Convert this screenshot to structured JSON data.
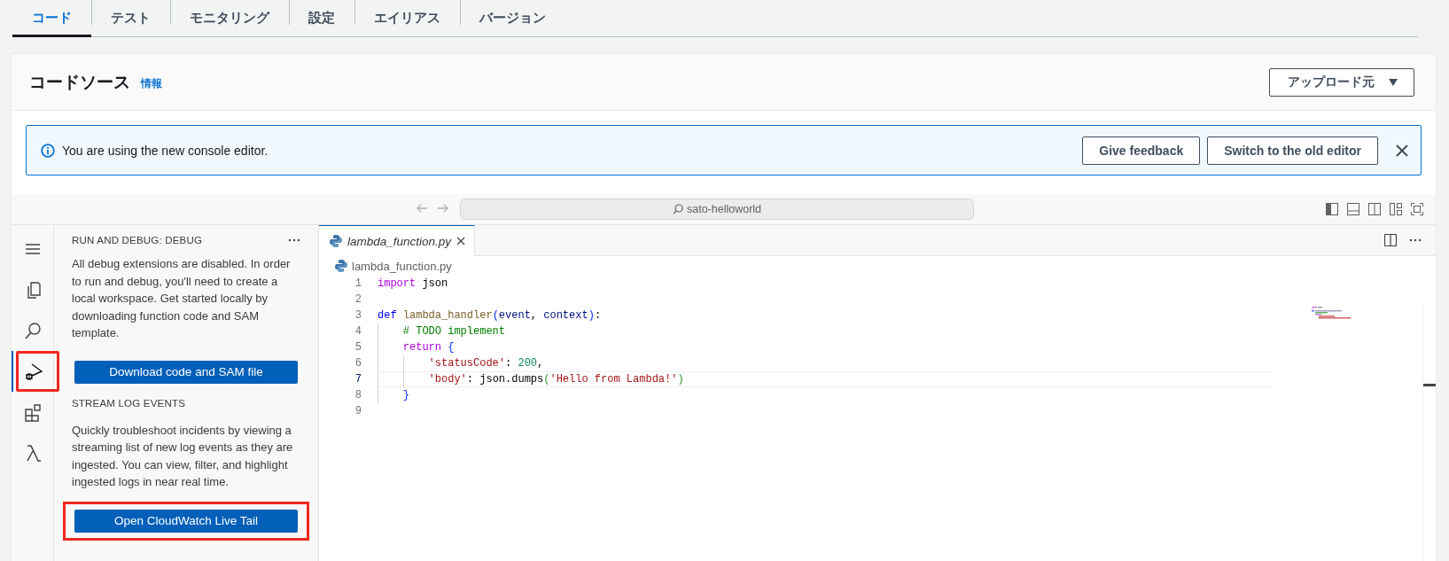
{
  "tabs": [
    {
      "label": "コード",
      "selected": true
    },
    {
      "label": "テスト",
      "selected": false
    },
    {
      "label": "モニタリング",
      "selected": false
    },
    {
      "label": "設定",
      "selected": false
    },
    {
      "label": "エイリアス",
      "selected": false
    },
    {
      "label": "バージョン",
      "selected": false
    }
  ],
  "code_source": {
    "title": "コードソース",
    "info_link": "情報",
    "upload_button": "アップロード元"
  },
  "alert": {
    "message": "You are using the new console editor.",
    "buttons": [
      "Give feedback",
      "Switch to the old editor"
    ]
  },
  "editor": {
    "title_search": "sato-helloworld",
    "activity_bar": [
      {
        "kind": "menu",
        "selected": false,
        "highlighted": false
      },
      {
        "kind": "explorer",
        "selected": false,
        "highlighted": false
      },
      {
        "kind": "search",
        "selected": false,
        "highlighted": false
      },
      {
        "kind": "debug",
        "selected": true,
        "highlighted": true
      },
      {
        "kind": "extensions",
        "selected": false,
        "highlighted": false
      },
      {
        "kind": "lambda",
        "selected": false,
        "highlighted": false
      }
    ],
    "sidebar": [
      {
        "title": "RUN AND DEBUG: DEBUG",
        "text": "All debug extensions are disabled. In order to run and debug, you'll need to create a local workspace. Get started locally by downloading function code and SAM template.",
        "button": "Download code and SAM file",
        "button_highlighted": false
      },
      {
        "title": "STREAM LOG EVENTS",
        "text": "Quickly troubleshoot incidents by viewing a streaming list of new log events as they are ingested. You can view, filter, and highlight ingested logs in near real time.",
        "button": "Open CloudWatch Live Tail",
        "button_highlighted": true
      }
    ],
    "open_tabs": [
      {
        "label": "lambda_function.py",
        "selected": true,
        "preview": true
      }
    ],
    "breadcrumb": "lambda_function.py",
    "lines": [
      {
        "number": "1",
        "current": false,
        "tokens": [
          {
            "text": "import",
            "kind": "keyword"
          },
          {
            "text": " json",
            "kind": "plain"
          }
        ]
      },
      {
        "number": "2",
        "current": false
      },
      {
        "number": "3",
        "current": false,
        "tokens": [
          {
            "text": "def",
            "kind": "storage"
          },
          {
            "text": " lambda_handler",
            "kind": "function"
          },
          {
            "text": "(",
            "kind": "bracket"
          },
          {
            "text": "event",
            "kind": "param"
          },
          {
            "text": ", ",
            "kind": "plain"
          },
          {
            "text": "context",
            "kind": "param"
          },
          {
            "text": ")",
            "kind": "bracket"
          },
          {
            "text": ":",
            "kind": "plain"
          }
        ]
      },
      {
        "number": "4",
        "current": false,
        "tokens": [
          {
            "text": "    # TODO implement",
            "kind": "comment"
          }
        ]
      },
      {
        "number": "5",
        "current": false,
        "tokens": [
          {
            "text": "    return",
            "kind": "keyword"
          },
          {
            "text": " {",
            "kind": "bracket"
          }
        ]
      },
      {
        "number": "6",
        "current": false,
        "tokens": [
          {
            "text": "        'statusCode'",
            "kind": "string"
          },
          {
            "text": ": ",
            "kind": "plain"
          },
          {
            "text": "200",
            "kind": "number"
          },
          {
            "text": ",",
            "kind": "plain"
          }
        ]
      },
      {
        "number": "7",
        "current": true,
        "tokens": [
          {
            "text": "        'body'",
            "kind": "string"
          },
          {
            "text": ": json.dumps",
            "kind": "plain"
          },
          {
            "text": "(",
            "kind": "bracket2"
          },
          {
            "text": "'Hello from Lambda!'",
            "kind": "string"
          },
          {
            "text": ")",
            "kind": "bracket2"
          }
        ]
      },
      {
        "number": "8",
        "current": false,
        "tokens": [
          {
            "text": "    }",
            "kind": "bracket"
          }
        ]
      },
      {
        "number": "9",
        "current": false
      }
    ]
  }
}
